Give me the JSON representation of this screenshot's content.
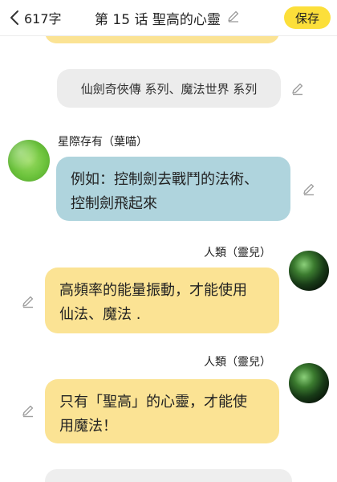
{
  "header": {
    "count": "617字",
    "title": "第 15 话 聖高的心靈",
    "save_label": "保存"
  },
  "narration": {
    "text": "仙劍奇俠傳 系列、魔法世界 系列"
  },
  "messages": [
    {
      "speaker": "星際存有（葉喵）",
      "line1": "例如：控制劍去戰鬥的法術、",
      "line2": "控制劍飛起來"
    },
    {
      "speaker": "人類（靈兒）",
      "line1": "高頻率的能量振動，才能使用",
      "line2": "仙法、魔法 ."
    },
    {
      "speaker": "人類（靈兒）",
      "line1": "只有「聖高」的心靈，才能使",
      "line2": "用魔法！"
    }
  ],
  "colors": {
    "accent": "#fcdf3a",
    "blue_bubble": "#afd4dd",
    "yellow_bubble": "#fbe394",
    "narration_bg": "#ececec"
  }
}
